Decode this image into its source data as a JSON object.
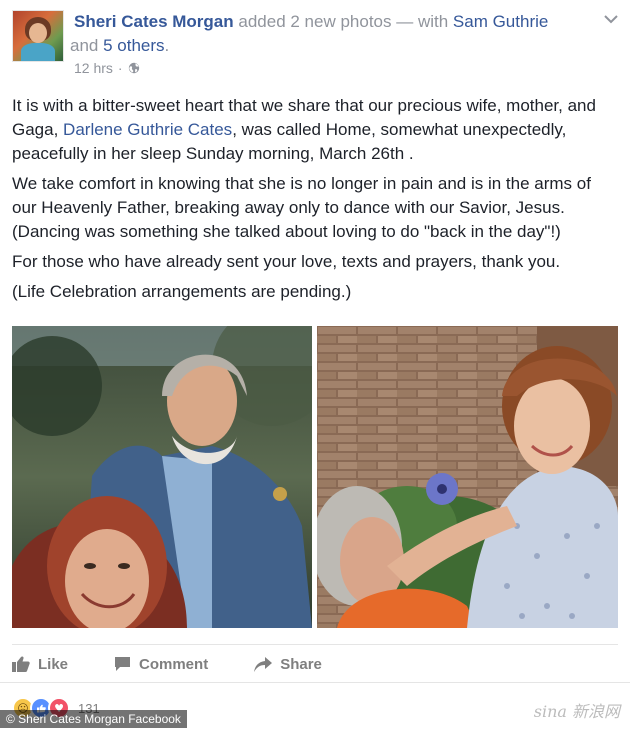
{
  "header": {
    "author": "Sheri Cates Morgan",
    "action_text": " added 2 new photos — with ",
    "tagged_person": "Sam Guthrie",
    "and_text": " and ",
    "others_link": "5 others",
    "period": ".",
    "time": "12 hrs",
    "dot": "·"
  },
  "body": {
    "p1_prefix": "It is with a bitter-sweet heart that we share that our precious wife, mother, and Gaga, ",
    "p1_link": "Darlene Guthrie Cates",
    "p1_suffix": ", was called Home, somewhat unexpectedly, peacefully in her sleep Sunday morning, March 26th .",
    "p2": "We take comfort in knowing that she is no longer in pain and is in the arms of our Heavenly Father, breaking away only to dance with our Savior, Jesus. (Dancing was something she talked about loving to do \"back in the day\"!)",
    "p3": "For those who have already sent your love, texts and prayers, thank you.",
    "p4": "(Life Celebration arrangements are pending.)"
  },
  "actions": {
    "like": "Like",
    "comment": "Comment",
    "share": "Share"
  },
  "reactions": {
    "count": "131"
  },
  "caption": "© Sheri Cates Morgan Facebook",
  "watermark": "sina 新浪网",
  "colors": {
    "link": "#365899",
    "meta": "#90949c",
    "text": "#1d2129",
    "action": "#7f7f7f"
  }
}
